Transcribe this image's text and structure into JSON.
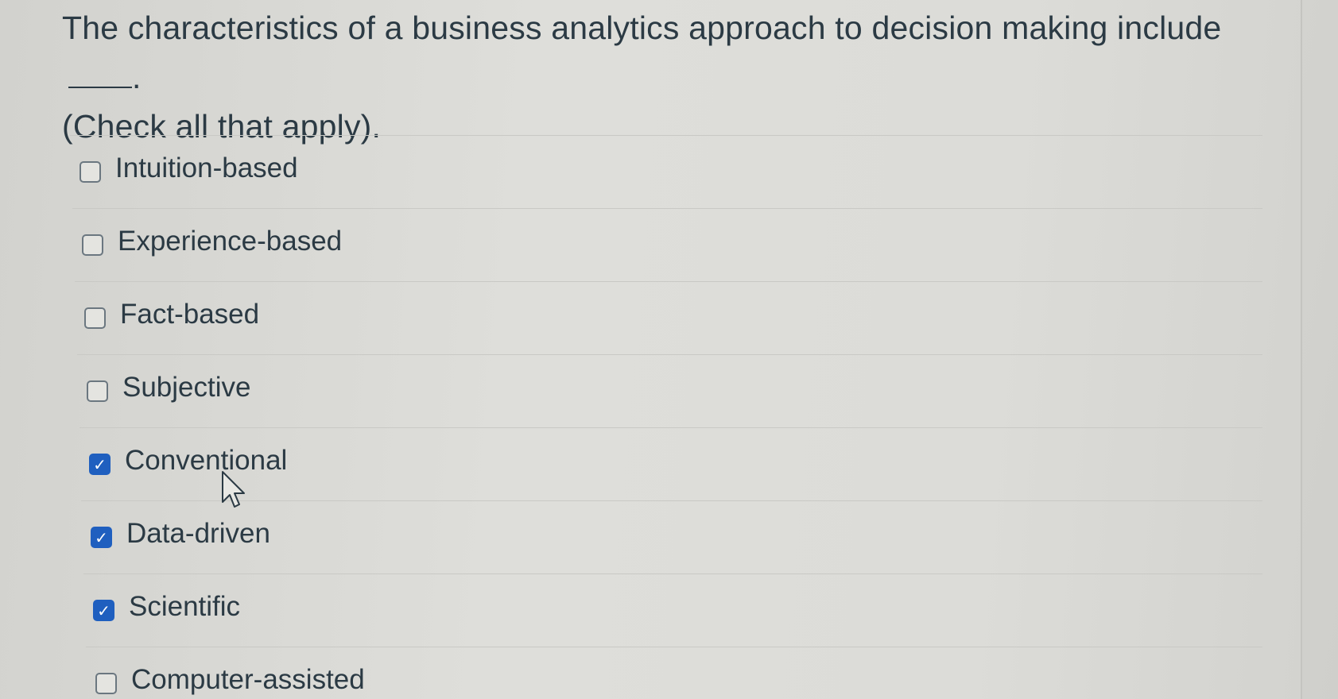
{
  "question": {
    "line1": "The characteristics of a business analytics approach to decision making include",
    "blank_suffix": ".",
    "line2": "(Check all that apply)."
  },
  "answers": [
    {
      "label": "Intuition-based",
      "checked": false
    },
    {
      "label": "Experience-based",
      "checked": false
    },
    {
      "label": "Fact-based",
      "checked": false
    },
    {
      "label": "Subjective",
      "checked": false
    },
    {
      "label": "Conventional",
      "checked": true
    },
    {
      "label": "Data-driven",
      "checked": true
    },
    {
      "label": "Scientific",
      "checked": true
    },
    {
      "label": "Computer-assisted",
      "checked": false
    }
  ],
  "colors": {
    "checkbox_checked": "#1f5fbf",
    "text": "#2b3a44"
  },
  "icons": {
    "check": "checkmark-icon",
    "cursor": "mouse-pointer-icon"
  }
}
